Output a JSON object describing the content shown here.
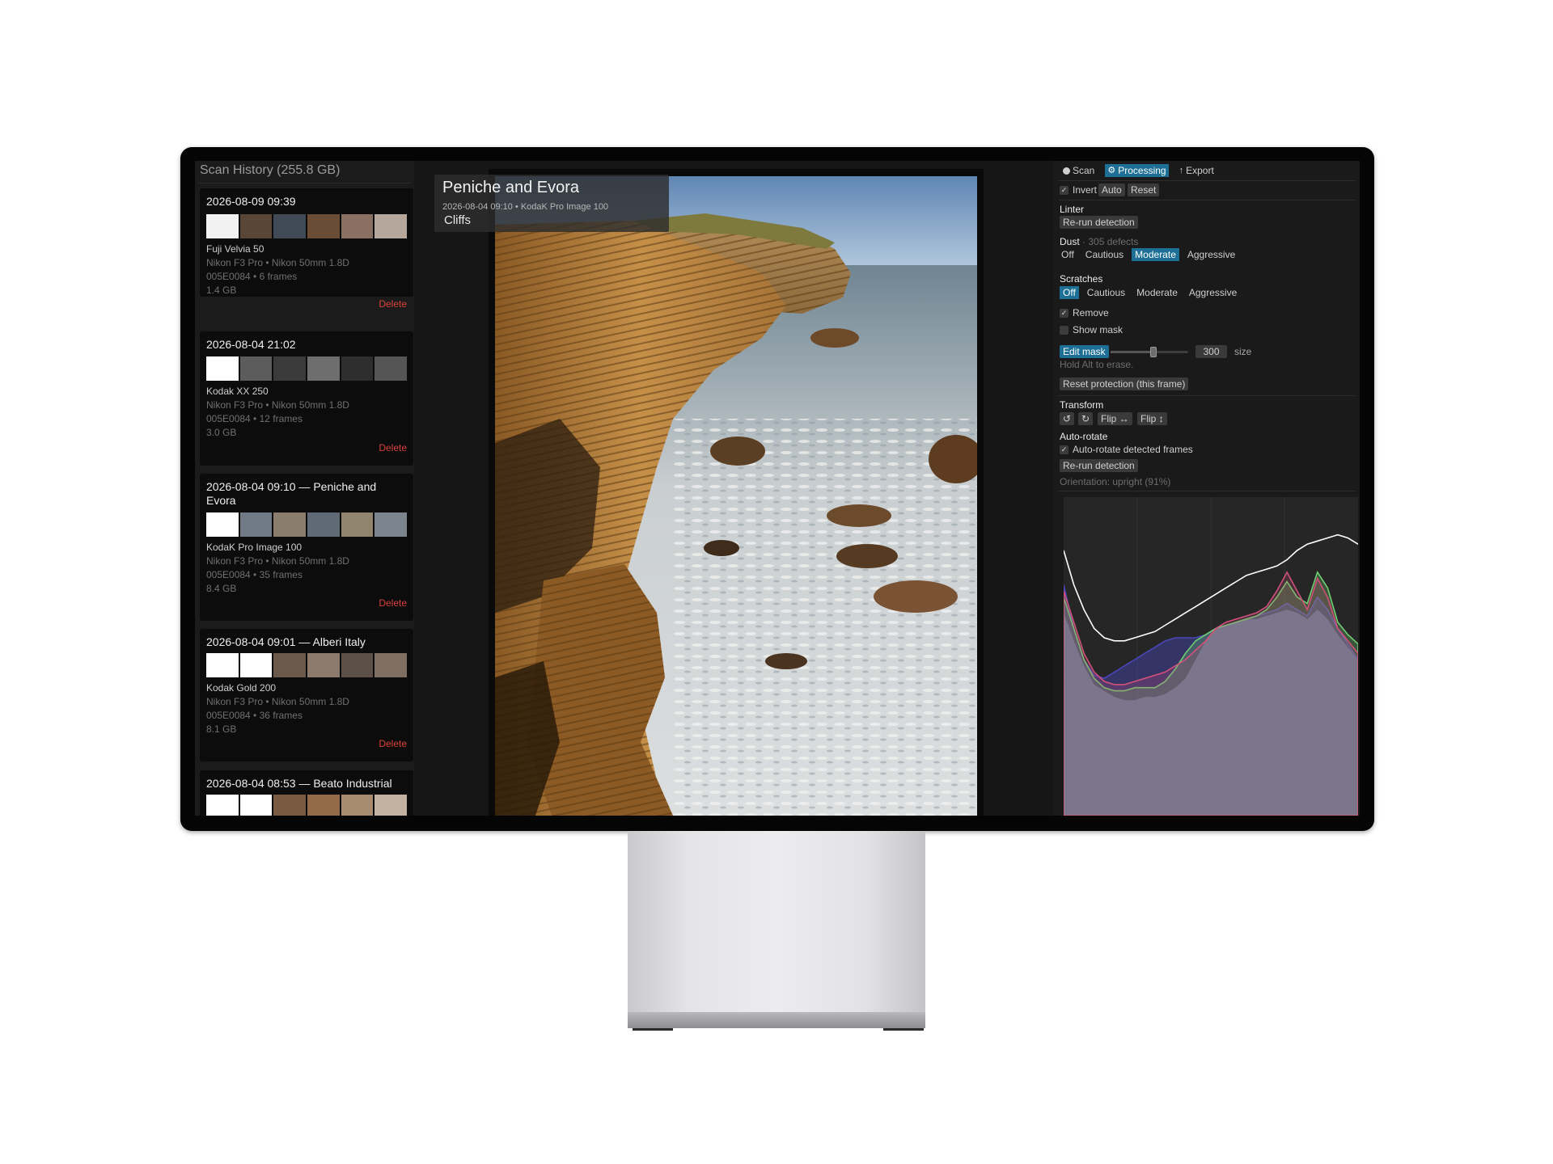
{
  "sidebar": {
    "title": "Scan History (255.8 GB)",
    "delete_label": "Delete",
    "scans": [
      {
        "title": "2026-08-09  09:39",
        "film": "Fuji Velvia 50",
        "camera": "Nikon F3 Pro  •  Nikon 50mm 1.8D",
        "roll": "005E0084  •  6 frames",
        "size": "1.4 GB",
        "thumb_colors": [
          "#f2f2f2",
          "#5a4636",
          "#3f4a56",
          "#6b4c35",
          "#8a7062",
          "#b5a79c"
        ]
      },
      {
        "title": "2026-08-04  21:02",
        "film": "Kodak XX 250",
        "camera": "Nikon F3 Pro  •  Nikon 50mm 1.8D",
        "roll": "005E0084  •  12 frames",
        "size": "3.0 GB",
        "thumb_colors": [
          "#ffffff",
          "#5c5c5c",
          "#3b3b3b",
          "#6e6e6e",
          "#2e2e2e",
          "#555555"
        ]
      },
      {
        "title": "2026-08-04  09:10 — Peniche and Evora",
        "film": "KodaK Pro Image 100",
        "camera": "Nikon F3 Pro  •  Nikon 50mm 1.8D",
        "roll": "005E0084  •  35 frames",
        "size": "8.4 GB",
        "thumb_colors": [
          "#ffffff",
          "#6f7a86",
          "#8a7d6e",
          "#5f6a76",
          "#92856f",
          "#7c848d"
        ]
      },
      {
        "title": "2026-08-04  09:01 — Alberi Italy",
        "film": "Kodak Gold 200",
        "camera": "Nikon F3 Pro  •  Nikon 50mm 1.8D",
        "roll": "005E0084  •  36 frames",
        "size": "8.1 GB",
        "thumb_colors": [
          "#ffffff",
          "#ffffff",
          "#6b5a4c",
          "#8c7b6d",
          "#5c5048",
          "#7f6f62"
        ]
      },
      {
        "title": "2026-08-04  08:53 — Beato Industrial",
        "thumb_colors": [
          "#ffffff",
          "#ffffff",
          "#7a5a40",
          "#946b49",
          "#a88a6e",
          "#c2b29f"
        ]
      }
    ]
  },
  "viewer": {
    "title": "Peniche and Evora",
    "meta": "2026-08-04  09:10   •   KodaK Pro Image 100",
    "subtitle": "Cliffs"
  },
  "panel": {
    "tabs": [
      {
        "label": "Scan",
        "icon": "circle-icon",
        "active": false
      },
      {
        "label": "Processing",
        "icon": "gear-icon",
        "active": true
      },
      {
        "label": "Export",
        "icon": "arrow-up-icon",
        "active": false
      }
    ],
    "invert_label": "Invert",
    "invert_checked": true,
    "auto_label": "Auto",
    "reset_label": "Reset",
    "linter_label": "Linter",
    "rerun_label": "Re-run detection",
    "dust_label": "Dust",
    "dust_defects": "· 305 defects",
    "dust_options": [
      "Off",
      "Cautious",
      "Moderate",
      "Aggressive"
    ],
    "dust_selected": "Moderate",
    "scratches_label": "Scratches",
    "scratch_options": [
      "Off",
      "Cautious",
      "Moderate",
      "Aggressive"
    ],
    "scratch_selected": "Off",
    "remove_label": "Remove",
    "remove_checked": true,
    "show_mask_label": "Show mask",
    "show_mask_checked": false,
    "edit_mask_label": "Edit mask",
    "brush_size": "300",
    "brush_fraction": 0.55,
    "size_label": "size",
    "hold_alt_hint": "Hold Alt to erase.",
    "reset_protection_label": "Reset protection (this frame)",
    "transform_label": "Transform",
    "rotate_ccw_icon": "rotate-ccw-icon",
    "rotate_cw_icon": "rotate-cw-icon",
    "flip_h_label": "Flip ↔",
    "flip_v_label": "Flip ↕",
    "auto_rotate_label": "Auto-rotate",
    "auto_rotate_check_label": "Auto-rotate detected frames",
    "auto_rotate_checked": true,
    "rerun_rotate_label": "Re-run detection",
    "orientation_text": "Orientation: upright (91%)"
  },
  "histogram": {
    "colors": {
      "luma": "#ffffff",
      "red": "#d0507a",
      "green": "#6fcf72",
      "blue": "#4a46b8",
      "gray": "#7a8594"
    },
    "luma": [
      0.85,
      0.74,
      0.66,
      0.6,
      0.57,
      0.56,
      0.56,
      0.57,
      0.58,
      0.59,
      0.61,
      0.63,
      0.65,
      0.67,
      0.69,
      0.71,
      0.73,
      0.75,
      0.77,
      0.78,
      0.79,
      0.8,
      0.82,
      0.85,
      0.87,
      0.88,
      0.89,
      0.9,
      0.89,
      0.87
    ],
    "red": [
      0.72,
      0.62,
      0.52,
      0.46,
      0.43,
      0.42,
      0.42,
      0.43,
      0.44,
      0.45,
      0.46,
      0.48,
      0.5,
      0.53,
      0.56,
      0.6,
      0.62,
      0.63,
      0.64,
      0.65,
      0.67,
      0.72,
      0.78,
      0.72,
      0.66,
      0.76,
      0.7,
      0.6,
      0.56,
      0.52
    ],
    "green": [
      0.7,
      0.6,
      0.5,
      0.44,
      0.41,
      0.4,
      0.4,
      0.41,
      0.41,
      0.41,
      0.43,
      0.47,
      0.52,
      0.56,
      0.58,
      0.6,
      0.61,
      0.62,
      0.63,
      0.64,
      0.66,
      0.7,
      0.75,
      0.7,
      0.68,
      0.78,
      0.73,
      0.62,
      0.58,
      0.55
    ],
    "blue": [
      0.74,
      0.6,
      0.5,
      0.45,
      0.44,
      0.46,
      0.48,
      0.5,
      0.52,
      0.54,
      0.56,
      0.57,
      0.57,
      0.57,
      0.58,
      0.6,
      0.61,
      0.62,
      0.63,
      0.64,
      0.65,
      0.66,
      0.68,
      0.66,
      0.64,
      0.7,
      0.66,
      0.6,
      0.55,
      0.5
    ],
    "base": [
      0.65,
      0.56,
      0.48,
      0.42,
      0.4,
      0.38,
      0.37,
      0.37,
      0.38,
      0.38,
      0.39,
      0.41,
      0.44,
      0.5,
      0.56,
      0.6,
      0.61,
      0.62,
      0.63,
      0.63,
      0.64,
      0.65,
      0.66,
      0.65,
      0.63,
      0.66,
      0.63,
      0.58,
      0.54,
      0.5
    ]
  }
}
